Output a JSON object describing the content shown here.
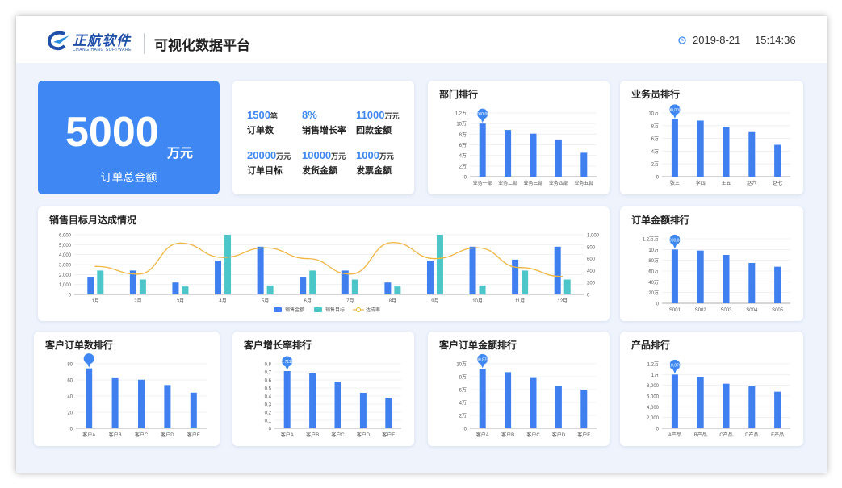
{
  "header": {
    "brand": "正航软件",
    "brand_sub": "CHANG HANG SOFTWARE",
    "title": "可视化数据平台",
    "date": "2019-8-21",
    "time": "15:14:36",
    "logo_icon": "brand-logo-icon",
    "clock_icon": "clock-icon"
  },
  "kpi_total": {
    "value": "5000",
    "unit": "万元",
    "label": "订单总金额"
  },
  "stats": [
    {
      "value": "1500",
      "unit": "笔",
      "label": "订单数"
    },
    {
      "value": "8%",
      "unit": "",
      "label": "销售增长率"
    },
    {
      "value": "11000",
      "unit": "万元",
      "label": "回款金额"
    },
    {
      "value": "20000",
      "unit": "万元",
      "label": "订单目标"
    },
    {
      "value": "10000",
      "unit": "万元",
      "label": "发货金额"
    },
    {
      "value": "1000",
      "unit": "万元",
      "label": "发票金额"
    }
  ],
  "colors": {
    "bar": "#3f7ff0",
    "bar2": "#4cc6c9",
    "line": "#efb640",
    "accent": "#3f88f3"
  },
  "chart_data": [
    {
      "id": "dept",
      "type": "bar",
      "title": "部门排行",
      "categories": [
        "业务一部",
        "业务二部",
        "业务三部",
        "业务四部",
        "业务五部"
      ],
      "yticks": [
        "0",
        "2万",
        "4万",
        "6万",
        "8万",
        "10万",
        "1.2万"
      ],
      "ylim": [
        0,
        120000
      ],
      "values": [
        100000,
        88000,
        81000,
        70000,
        45000
      ],
      "marker": {
        "index": 0,
        "label": "1,000,000"
      }
    },
    {
      "id": "sales",
      "type": "bar",
      "title": "业务员排行",
      "categories": [
        "张三",
        "李四",
        "王五",
        "赵六",
        "赵七"
      ],
      "yticks": [
        "0",
        "2万",
        "4万",
        "6万",
        "8万",
        "10万"
      ],
      "ylim": [
        0,
        100000
      ],
      "values": [
        90000,
        88000,
        78000,
        70000,
        50000
      ],
      "marker": {
        "index": 0,
        "label": "90,000"
      }
    },
    {
      "id": "monthly",
      "type": "bar+line",
      "title": "销售目标月达成情况",
      "categories": [
        "1月",
        "2月",
        "3月",
        "4月",
        "5月",
        "6月",
        "7月",
        "8月",
        "9月",
        "10月",
        "11月",
        "12月"
      ],
      "yticks_left": [
        "0",
        "1,000",
        "2,000",
        "3,000",
        "4,000",
        "5,000",
        "6,000"
      ],
      "yticks_right": [
        "0",
        "200",
        "400",
        "600",
        "800",
        "1,000"
      ],
      "ylim_left": [
        0,
        6000
      ],
      "ylim_right": [
        0,
        1000
      ],
      "series": [
        {
          "name": "销售金额",
          "kind": "bar",
          "values": [
            1700,
            2400,
            1200,
            3400,
            4800,
            1700,
            2400,
            1200,
            3400,
            4800,
            3500,
            4800
          ]
        },
        {
          "name": "销售目标",
          "kind": "bar",
          "values": [
            2400,
            1500,
            800,
            6000,
            900,
            2400,
            1500,
            800,
            6000,
            900,
            2400,
            1500
          ]
        },
        {
          "name": "达成率",
          "kind": "line",
          "values": [
            470,
            340,
            860,
            620,
            780,
            600,
            340,
            870,
            600,
            780,
            450,
            300
          ]
        }
      ],
      "legend": "bottom"
    },
    {
      "id": "orderamt",
      "type": "bar",
      "title": "订单金额排行",
      "categories": [
        "S001",
        "S002",
        "S003",
        "S004",
        "S005"
      ],
      "yticks": [
        "0",
        "20万",
        "40万",
        "60万",
        "80万",
        "10万",
        "1.2万万"
      ],
      "ylim": [
        0,
        120
      ],
      "values": [
        100,
        98,
        90,
        75,
        68
      ],
      "marker": {
        "index": 0,
        "label": "1,000,000"
      }
    },
    {
      "id": "custcount",
      "type": "bar",
      "title": "客户订单数排行",
      "categories": [
        "客户A",
        "客户B",
        "客户C",
        "客户D",
        "客户E"
      ],
      "yticks": [
        "0",
        "20",
        "40",
        "60",
        "80"
      ],
      "ylim": [
        0,
        85
      ],
      "values": [
        79,
        66,
        64,
        57,
        47
      ],
      "marker": {
        "index": 0,
        "label": ""
      }
    },
    {
      "id": "custgrowth",
      "type": "bar",
      "title": "客户增长率排行",
      "categories": [
        "客户A",
        "客户B",
        "客户C",
        "客户D",
        "客户E"
      ],
      "yticks": [
        "0",
        "0.1",
        "0.2",
        "0.3",
        "0.4",
        "0.5",
        "0.6",
        "0.7",
        "0.8"
      ],
      "ylim": [
        0,
        0.8
      ],
      "values": [
        0.71,
        0.68,
        0.58,
        0.44,
        0.38
      ],
      "marker": {
        "index": 0,
        "label": "0.7111"
      }
    },
    {
      "id": "custamt",
      "type": "bar",
      "title": "客户订单金额排行",
      "categories": [
        "客户A",
        "客户B",
        "客户C",
        "客户D",
        "客户E"
      ],
      "yticks": [
        "0",
        "2万",
        "4万",
        "6万",
        "8万",
        "10万"
      ],
      "ylim": [
        0,
        100000
      ],
      "values": [
        92000,
        87000,
        78000,
        66000,
        60000
      ],
      "marker": {
        "index": 0,
        "label": "90,876"
      }
    },
    {
      "id": "product",
      "type": "bar",
      "title": "产品排行",
      "categories": [
        "A产品",
        "B产品",
        "C产品",
        "D产品",
        "E产品"
      ],
      "yticks": [
        "0",
        "2,000",
        "4,000",
        "6,000",
        "8,000",
        "1万",
        "1.2万"
      ],
      "ylim": [
        0,
        12000
      ],
      "values": [
        10000,
        9500,
        8300,
        7800,
        6800
      ],
      "marker": {
        "index": 0,
        "label": "10,076"
      }
    }
  ]
}
